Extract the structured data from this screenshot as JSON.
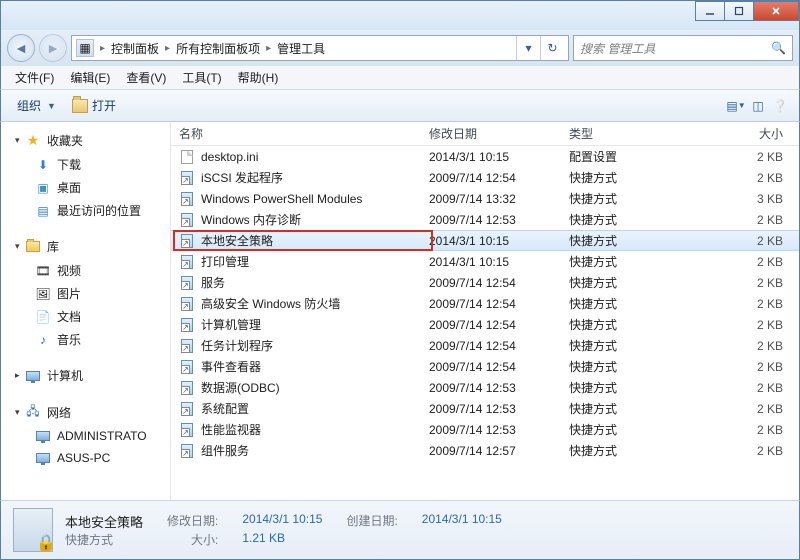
{
  "titlebar": {
    "min": "",
    "max": "",
    "close": ""
  },
  "nav": {
    "crumb1": "控制面板",
    "crumb2": "所有控制面板项",
    "crumb3": "管理工具",
    "search_placeholder": "搜索 管理工具"
  },
  "menu": {
    "file": "文件(F)",
    "edit": "编辑(E)",
    "view": "查看(V)",
    "tools": "工具(T)",
    "help": "帮助(H)"
  },
  "toolbar": {
    "organize": "组织",
    "open": "打开"
  },
  "sidebar": {
    "favorites": "收藏夹",
    "downloads": "下载",
    "desktop": "桌面",
    "recent": "最近访问的位置",
    "libraries": "库",
    "videos": "视频",
    "pictures": "图片",
    "documents": "文档",
    "music": "音乐",
    "computer": "计算机",
    "network": "网络",
    "net1": "ADMINISTRATO",
    "net2": "ASUS-PC"
  },
  "columns": {
    "name": "名称",
    "date": "修改日期",
    "type": "类型",
    "size": "大小"
  },
  "files": [
    {
      "name": "desktop.ini",
      "date": "2014/3/1 10:15",
      "type": "配置设置",
      "size": "2 KB",
      "icon": "ini"
    },
    {
      "name": "iSCSI 发起程序",
      "date": "2009/7/14 12:54",
      "type": "快捷方式",
      "size": "2 KB",
      "icon": "link"
    },
    {
      "name": "Windows PowerShell Modules",
      "date": "2009/7/14 13:32",
      "type": "快捷方式",
      "size": "3 KB",
      "icon": "link"
    },
    {
      "name": "Windows 内存诊断",
      "date": "2009/7/14 12:53",
      "type": "快捷方式",
      "size": "2 KB",
      "icon": "link"
    },
    {
      "name": "本地安全策略",
      "date": "2014/3/1 10:15",
      "type": "快捷方式",
      "size": "2 KB",
      "icon": "link",
      "selected": true,
      "highlight": true
    },
    {
      "name": "打印管理",
      "date": "2014/3/1 10:15",
      "type": "快捷方式",
      "size": "2 KB",
      "icon": "link"
    },
    {
      "name": "服务",
      "date": "2009/7/14 12:54",
      "type": "快捷方式",
      "size": "2 KB",
      "icon": "link"
    },
    {
      "name": "高级安全 Windows 防火墙",
      "date": "2009/7/14 12:54",
      "type": "快捷方式",
      "size": "2 KB",
      "icon": "link"
    },
    {
      "name": "计算机管理",
      "date": "2009/7/14 12:54",
      "type": "快捷方式",
      "size": "2 KB",
      "icon": "link"
    },
    {
      "name": "任务计划程序",
      "date": "2009/7/14 12:54",
      "type": "快捷方式",
      "size": "2 KB",
      "icon": "link"
    },
    {
      "name": "事件查看器",
      "date": "2009/7/14 12:54",
      "type": "快捷方式",
      "size": "2 KB",
      "icon": "link"
    },
    {
      "name": "数据源(ODBC)",
      "date": "2009/7/14 12:53",
      "type": "快捷方式",
      "size": "2 KB",
      "icon": "link"
    },
    {
      "name": "系统配置",
      "date": "2009/7/14 12:53",
      "type": "快捷方式",
      "size": "2 KB",
      "icon": "link"
    },
    {
      "name": "性能监视器",
      "date": "2009/7/14 12:53",
      "type": "快捷方式",
      "size": "2 KB",
      "icon": "link"
    },
    {
      "name": "组件服务",
      "date": "2009/7/14 12:57",
      "type": "快捷方式",
      "size": "2 KB",
      "icon": "link"
    }
  ],
  "details": {
    "title": "本地安全策略",
    "subtitle": "快捷方式",
    "mod_label": "修改日期:",
    "mod_val": "2014/3/1 10:15",
    "size_label": "大小:",
    "size_val": "1.21 KB",
    "create_label": "创建日期:",
    "create_val": "2014/3/1 10:15"
  }
}
